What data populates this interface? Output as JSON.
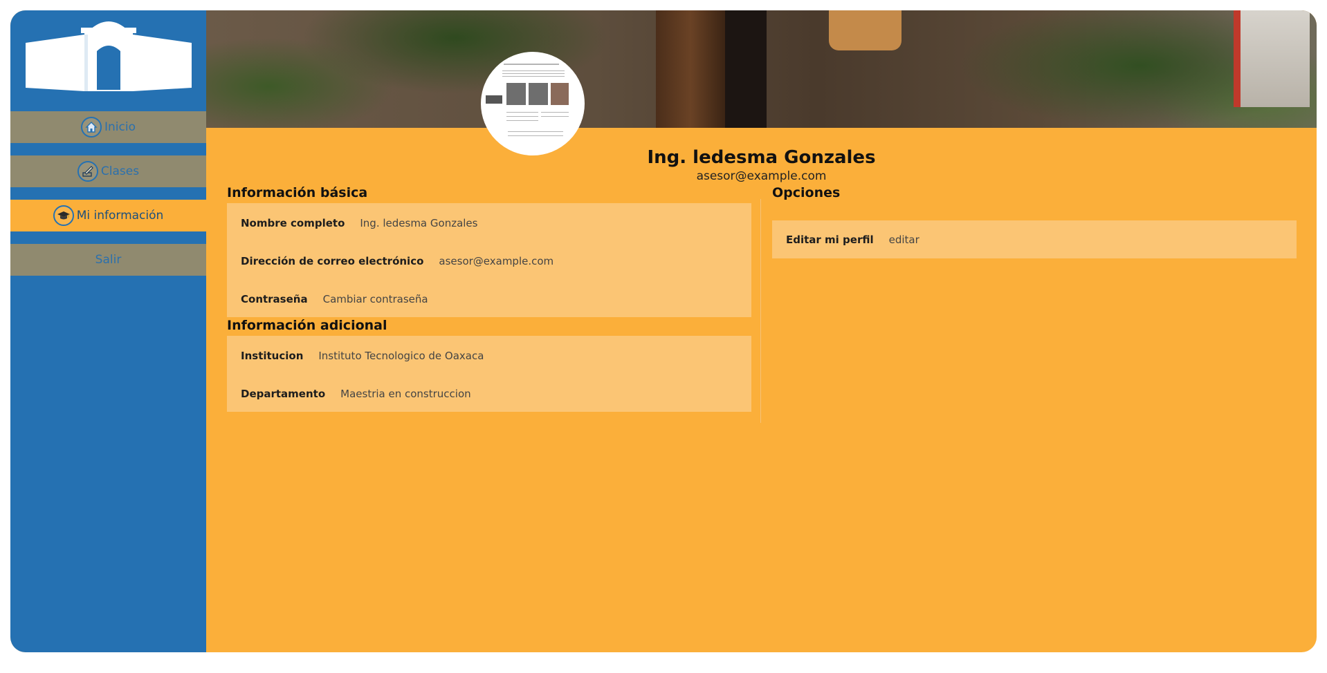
{
  "colors": {
    "sidebar": "#2571b2",
    "accent": "#fbaf3a",
    "nav_inactive": "#908a6f",
    "card": "#fbc574"
  },
  "sidebar": {
    "logo_icon": "building-arch-logo",
    "items": [
      {
        "label": "Inicio",
        "icon": "home-icon",
        "active": false
      },
      {
        "label": "Clases",
        "icon": "pencil-icon",
        "active": false
      },
      {
        "label": "Mi información",
        "icon": "graduation-cap-icon",
        "active": true
      },
      {
        "label": "Salir",
        "icon": "",
        "active": false
      }
    ]
  },
  "profile": {
    "name": "Ing. ledesma Gonzales",
    "email": "asesor@example.com"
  },
  "basic_info": {
    "title": "Información básica",
    "full_name_label": "Nombre completo",
    "full_name_value": "Ing. ledesma Gonzales",
    "email_label": "Dirección de correo electrónico",
    "email_value": "asesor@example.com",
    "password_label": "Contraseña",
    "password_value": "Cambiar contraseña"
  },
  "additional_info": {
    "title": "Información adicional",
    "institution_label": "Institucion",
    "institution_value": "Instituto Tecnologico de Oaxaca",
    "department_label": "Departamento",
    "department_value": "Maestria en construccion"
  },
  "options": {
    "title": "Opciones",
    "edit_label": "Editar mi perfil",
    "edit_value": "editar"
  }
}
